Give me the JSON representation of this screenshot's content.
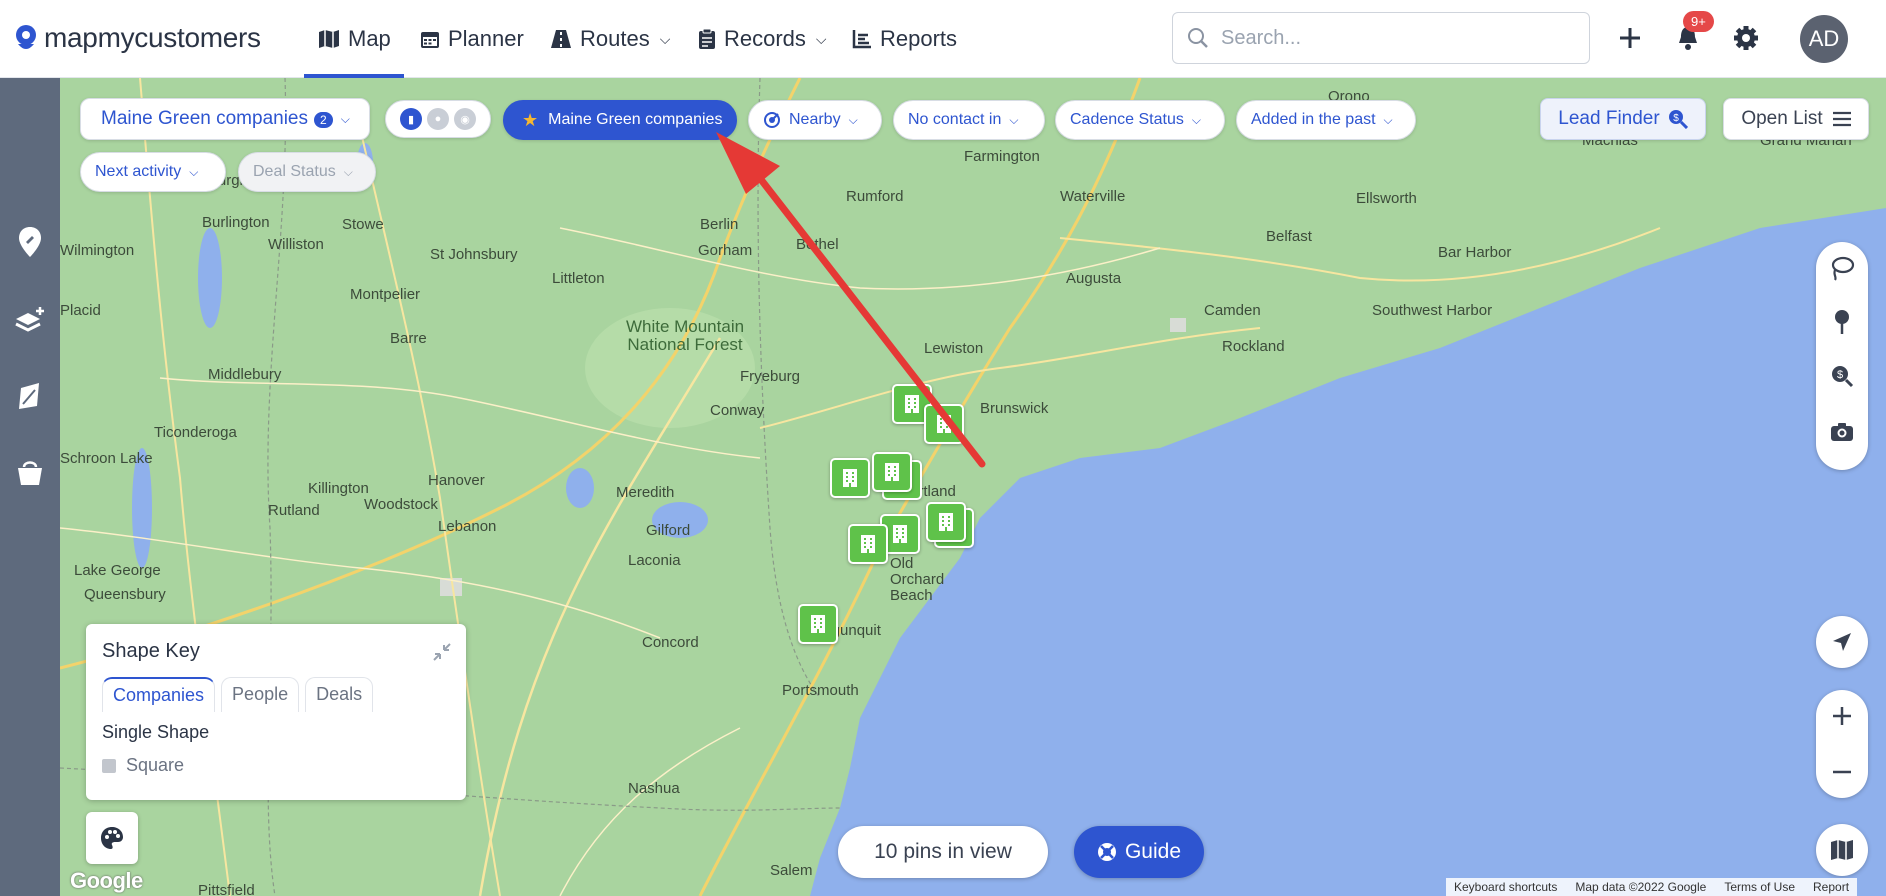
{
  "app": {
    "brand": "mapmycustomers"
  },
  "nav": {
    "map": "Map",
    "planner": "Planner",
    "routes": "Routes",
    "records": "Records",
    "reports": "Reports"
  },
  "search": {
    "placeholder": "Search..."
  },
  "notifications": {
    "badge": "9+"
  },
  "user": {
    "initials": "AD"
  },
  "filters": {
    "view_name": "Maine Green companies",
    "view_count": "2",
    "active_group": "Maine Green companies",
    "nearby": "Nearby",
    "no_contact": "No contact in",
    "cadence": "Cadence Status",
    "added": "Added in the past",
    "next_activity": "Next activity",
    "deal_status": "Deal Status"
  },
  "actions": {
    "lead_finder": "Lead Finder",
    "open_list": "Open List"
  },
  "shape_key": {
    "title": "Shape Key",
    "tabs": [
      "Companies",
      "People",
      "Deals"
    ],
    "active_tab": "Companies",
    "mode": "Single Shape",
    "shape": "Square"
  },
  "status": {
    "pins_in_view": "10 pins in view",
    "guide": "Guide"
  },
  "map": {
    "attribution": [
      "Keyboard shortcuts",
      "Map data ©2022 Google",
      "Terms of Use",
      "Report"
    ],
    "google": "Google",
    "labels": [
      "Plattsburgh",
      "Burlington",
      "Stowe",
      "St Johnsbury",
      "Williston",
      "Wilmington",
      "Montpelier",
      "Placid",
      "Barre",
      "Middlebury",
      "Ticonderoga",
      "Schroon Lake",
      "Killington",
      "Rutland",
      "Woodstock",
      "Hanover",
      "Lebanon",
      "Lake George",
      "Queensbury",
      "Littleton",
      "Berlin",
      "Gorham",
      "Bethel",
      "Rumford",
      "Farmington",
      "Waterville",
      "Augusta",
      "Belfast",
      "Ellsworth",
      "Bar Harbor",
      "Camden",
      "Rockland",
      "Southwest Harbor",
      "Lewiston",
      "Brunswick",
      "Fryeburg",
      "Conway",
      "Meredith",
      "Gilford",
      "Laconia",
      "Concord",
      "Nashua",
      "Portsmouth",
      "Salem",
      "Pittsfield",
      "Orono",
      "Machias",
      "Grand Manan",
      "White Mountain National Forest",
      "Portland",
      "Old Orchard Beach",
      "Ogunquit"
    ]
  },
  "colors": {
    "accent": "#2e55d0",
    "pin": "#5fc24a",
    "sidebar": "#5e6a7d",
    "annotation_arrow": "#e53935",
    "water": "#8fb0ec",
    "land": "#a7d39f"
  },
  "icons": {
    "logo": "pin-logo-icon",
    "map": "map-icon",
    "planner": "calendar-icon",
    "routes": "road-icon",
    "records": "clipboard-icon",
    "reports": "chart-icon"
  }
}
